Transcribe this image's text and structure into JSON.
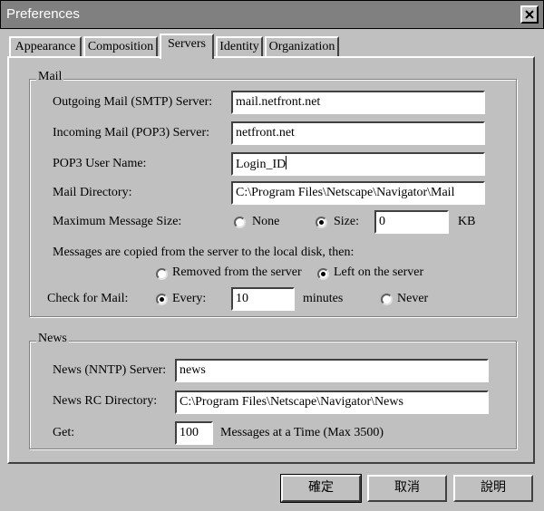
{
  "window": {
    "title": "Preferences"
  },
  "tabs": [
    {
      "label": "Appearance",
      "active": false
    },
    {
      "label": "Composition",
      "active": false
    },
    {
      "label": "Servers",
      "active": true
    },
    {
      "label": "Identity",
      "active": false
    },
    {
      "label": "Organization",
      "active": false
    }
  ],
  "mail": {
    "legend": "Mail",
    "smtp_label": "Outgoing Mail (SMTP) Server:",
    "smtp_value": "mail.netfront.net",
    "pop3_label": "Incoming Mail (POP3) Server:",
    "pop3_value": "netfront.net",
    "username_label": "POP3 User Name:",
    "username_value": "Login_ID",
    "directory_label": "Mail Directory:",
    "directory_value": "C:\\Program Files\\Netscape\\Navigator\\Mail",
    "max_size_label": "Maximum Message Size:",
    "max_size_none": "None",
    "max_size_size": "Size:",
    "max_size_selected": "size",
    "max_size_value": "0",
    "max_size_unit": "KB",
    "copy_text": "Messages are copied from the server to the local disk, then:",
    "copy_removed": "Removed from the server",
    "copy_left": "Left on the server",
    "copy_selected": "left",
    "check_label": "Check for Mail:",
    "check_every": "Every:",
    "check_value": "10",
    "check_unit": "minutes",
    "check_never": "Never",
    "check_selected": "every"
  },
  "news": {
    "legend": "News",
    "server_label": "News (NNTP) Server:",
    "server_value": "news",
    "rc_label": "News RC Directory:",
    "rc_value": "C:\\Program Files\\Netscape\\Navigator\\News",
    "get_label": "Get:",
    "get_value": "100",
    "get_suffix": "Messages at a Time (Max 3500)"
  },
  "buttons": {
    "ok": "確定",
    "cancel": "取消",
    "help": "說明"
  }
}
